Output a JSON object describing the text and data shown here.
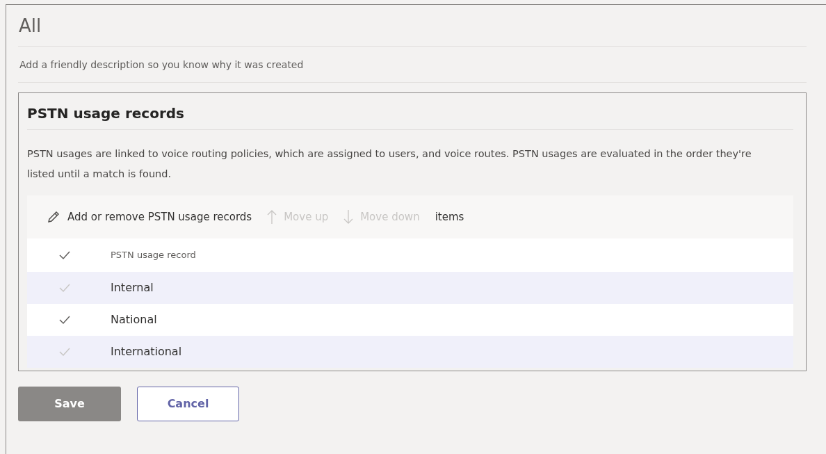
{
  "name_field": {
    "value": "All"
  },
  "description_field": {
    "placeholder": "Add a friendly description so you know why it was created"
  },
  "section": {
    "title": "PSTN usage records",
    "text": "PSTN usages are linked to voice routing policies, which are assigned to users, and voice routes. PSTN usages are evaluated in the order they're listed until a match is found."
  },
  "toolbar": [
    {
      "kind": "edit",
      "label": "Add or remove PSTN usage records",
      "disabled": false
    },
    {
      "kind": "up",
      "label": "Move up",
      "disabled": true
    },
    {
      "kind": "down",
      "label": "Move down",
      "disabled": true
    },
    {
      "kind": "text",
      "label": "items",
      "disabled": false
    }
  ],
  "table": {
    "header": "PSTN usage record",
    "rows": [
      {
        "name": "Internal",
        "selected": true
      },
      {
        "name": "National",
        "selected": false
      },
      {
        "name": "International",
        "selected": true
      }
    ]
  },
  "buttons": [
    {
      "label": "Save",
      "kind": "primary",
      "disabled": true
    },
    {
      "label": "Cancel",
      "kind": "secondary",
      "disabled": false
    }
  ]
}
